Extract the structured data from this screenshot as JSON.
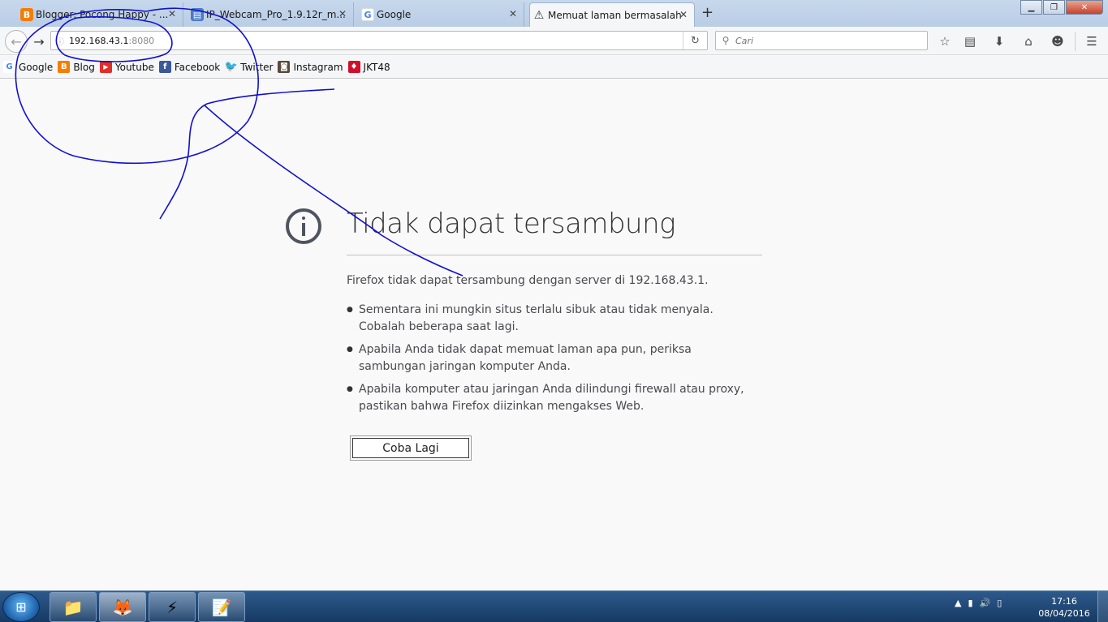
{
  "tabs": [
    {
      "label": "Blogger: Pocong Happy - ...",
      "icon": "blogger-icon",
      "color": "#f57d00"
    },
    {
      "label": "IP_Webcam_Pro_1.9.12r_m...",
      "icon": "document-icon",
      "color": "#4a7ac8"
    },
    {
      "label": "Google",
      "icon": "google-icon",
      "color": "#4285f4"
    },
    {
      "label": "Memuat laman bermasalah",
      "icon": "warning-icon",
      "color": "#f0c000"
    }
  ],
  "urlbar": {
    "host": "192.168.43.1",
    "port": ":8080"
  },
  "search": {
    "placeholder": "Cari"
  },
  "bookmarks": [
    {
      "label": "Google",
      "icon": "google-icon"
    },
    {
      "label": "Blog",
      "icon": "blogger-icon"
    },
    {
      "label": "Youtube",
      "icon": "youtube-icon"
    },
    {
      "label": "Facebook",
      "icon": "facebook-icon"
    },
    {
      "label": "Twitter",
      "icon": "twitter-icon"
    },
    {
      "label": "Instagram",
      "icon": "instagram-icon"
    },
    {
      "label": "JKT48",
      "icon": "jkt48-icon"
    }
  ],
  "error": {
    "title": "Tidak dapat tersambung",
    "description": "Firefox tidak dapat tersambung dengan server di 192.168.43.1.",
    "bullets": [
      "Sementara ini mungkin situs terlalu sibuk atau tidak menyala. Cobalah beberapa saat lagi.",
      "Apabila Anda tidak dapat memuat laman apa pun, periksa sambungan jaringan komputer Anda.",
      "Apabila komputer atau jaringan Anda dilindungi firewall atau proxy, pastikan bahwa Firefox diizinkan mengakses Web."
    ],
    "retry_label": "Coba Lagi"
  },
  "taskbar": {
    "time": "17:16",
    "date": "08/04/2016"
  },
  "annotation_color": "#1010d0"
}
